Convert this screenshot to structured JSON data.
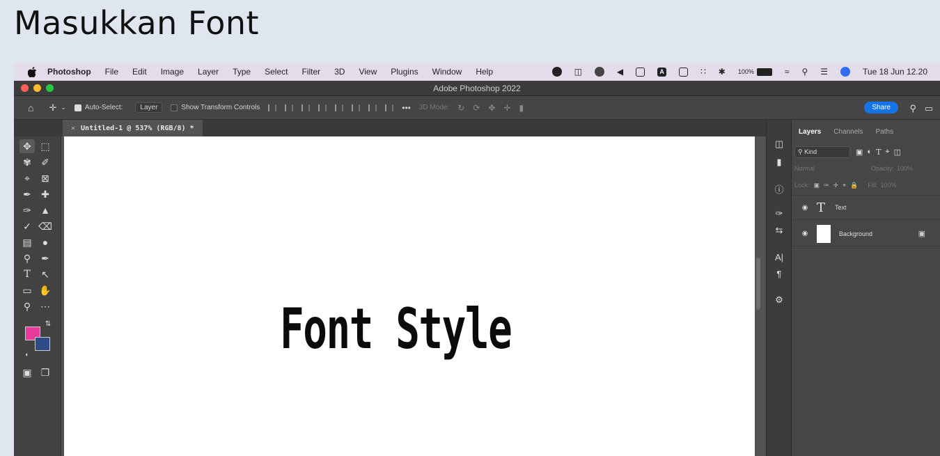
{
  "slide_title": "Masukkan Font",
  "menubar": {
    "app_name": "Photoshop",
    "items": [
      "File",
      "Edit",
      "Image",
      "Layer",
      "Type",
      "Select",
      "Filter",
      "3D",
      "View",
      "Plugins",
      "Window",
      "Help"
    ],
    "battery": "100%",
    "clock": "Tue 18 Jun  12.20"
  },
  "window": {
    "title": "Adobe Photoshop 2022"
  },
  "options": {
    "auto_select_label": "Auto-Select:",
    "auto_select_value": "Layer",
    "show_transform": "Show Transform Controls",
    "mode_3d": "3D Mode:",
    "share": "Share"
  },
  "document": {
    "tab_title": "Untitled-1 @ 537% (RGB/8) *",
    "canvas_text": "Font Style"
  },
  "colors": {
    "foreground": "#e8399c",
    "background": "#2f4b86",
    "share": "#1473e6"
  },
  "layers_panel": {
    "tabs": [
      "Layers",
      "Channels",
      "Paths"
    ],
    "filter_kind": "Kind",
    "blend_mode": "Normal",
    "opacity_label": "Opacity:",
    "opacity_value": "100%",
    "lock_label": "Lock:",
    "fill_label": "Fill:",
    "fill_value": "100%",
    "layers": [
      {
        "name": "Text",
        "type": "text"
      },
      {
        "name": "Background",
        "type": "image",
        "locked": true
      }
    ]
  }
}
